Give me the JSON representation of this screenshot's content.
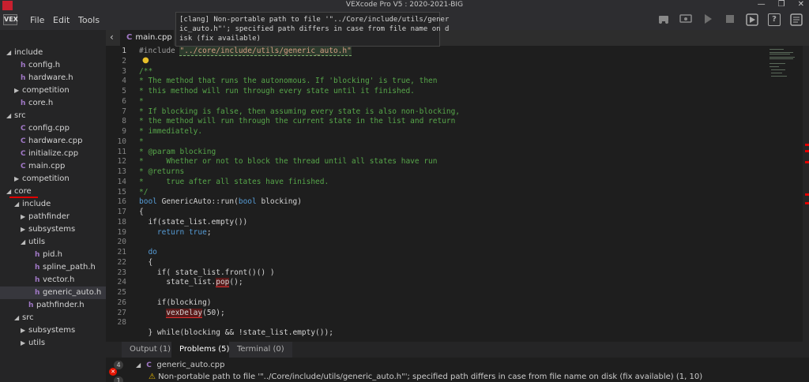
{
  "window": {
    "title": "VEXcode Pro V5 : 2020-2021-BIG",
    "controls": [
      "—",
      "❐",
      "✕"
    ]
  },
  "menu": {
    "logo": "VEX",
    "items": [
      "File",
      "Edit",
      "Tools"
    ]
  },
  "toolbar": {
    "help_label": "?",
    "icons": [
      "robot-icon",
      "devices-icon",
      "play-icon",
      "stop-icon",
      "download-icon",
      "help-icon",
      "user-manual-icon"
    ]
  },
  "explorer": {
    "items": [
      {
        "label": "include",
        "type": "folder",
        "expanded": true
      },
      {
        "label": "config.h",
        "type": "file"
      },
      {
        "label": "hardware.h",
        "type": "file"
      },
      {
        "label": "competition",
        "type": "folder",
        "expanded": false
      },
      {
        "label": "core.h",
        "type": "file"
      },
      {
        "label": "src",
        "type": "folder",
        "expanded": true
      },
      {
        "label": "config.cpp",
        "type": "file"
      },
      {
        "label": "hardware.cpp",
        "type": "file"
      },
      {
        "label": "initialize.cpp",
        "type": "file"
      },
      {
        "label": "main.cpp",
        "type": "file"
      },
      {
        "label": "competition",
        "type": "folder",
        "expanded": false
      },
      {
        "label": "core",
        "type": "folder",
        "expanded": true
      },
      {
        "label": "include",
        "type": "folder",
        "expanded": true
      },
      {
        "label": "pathfinder",
        "type": "folder",
        "expanded": false
      },
      {
        "label": "subsystems",
        "type": "folder",
        "expanded": false
      },
      {
        "label": "utils",
        "type": "folder",
        "expanded": true
      },
      {
        "label": "pid.h",
        "type": "file"
      },
      {
        "label": "spline_path.h",
        "type": "file"
      },
      {
        "label": "vector.h",
        "type": "file"
      },
      {
        "label": "generic_auto.h",
        "type": "file",
        "selected": true
      },
      {
        "label": "pathfinder.h",
        "type": "file"
      },
      {
        "label": "src",
        "type": "folder",
        "expanded": true
      },
      {
        "label": "subsystems",
        "type": "folder",
        "expanded": false
      },
      {
        "label": "utils",
        "type": "folder",
        "expanded": false
      }
    ]
  },
  "editor": {
    "tab_label": "main.cpp",
    "tab_icon": "C",
    "tooltip": "[clang] Non-portable path to file '\"../Core/include/utils/gener\nic_auto.h\"'; specified path differs in case from file name on d\nisk (fix available)",
    "line_numbers": [
      "1",
      "2",
      "3",
      "4",
      "5",
      "6",
      "7",
      "8",
      "9",
      "10",
      "11",
      "12",
      "13",
      "14",
      "15",
      "16",
      "17",
      "18",
      "19",
      "20",
      "21",
      "22",
      "23",
      "24",
      "25",
      "26",
      "27",
      "28"
    ],
    "lines": {
      "l1_directive": "#include ",
      "l1_path": "\"../core/include/utils/generic_auto.h\"",
      "l3": "/**",
      "l4": "* The method that runs the autonomous. If 'blocking' is true, then",
      "l5": "* this method will run through every state until it finished.",
      "l6": "*",
      "l7": "* If blocking is false, then assuming every state is also non-blocking,",
      "l8": "* the method will run through the current state in the list and return",
      "l9": "* immediately.",
      "l10": "*",
      "l11": "* @param blocking",
      "l12": "*     Whether or not to block the thread until all states have run",
      "l13": "* @returns",
      "l14": "*     true after all states have finished.",
      "l15": "*/",
      "l16_kw": "bool",
      "l16_rest": " GenericAuto::run(",
      "l16_kw2": "bool",
      "l16_end": " blocking)",
      "l17": "{",
      "l18": "  if(state_list.empty())",
      "l19_kw": "return",
      "l19_kw2": "true",
      "l19_end": ";",
      "l21": "  do",
      "l22": "  {",
      "l23": "    if( state_list.front()() )",
      "l24_a": "      state_list.",
      "l24_b": "pop",
      "l24_c": "();",
      "l26": "    if(blocking)",
      "l27_a": "      ",
      "l27_b": "vexDelay",
      "l27_c": "(50);",
      "l29": "  } while(blocking && !state_list.empty());"
    }
  },
  "panel": {
    "tabs": [
      "Output (1)",
      "Problems (5)",
      "Terminal (0)"
    ],
    "active_tab": "Problems (5)",
    "badges": [
      "4",
      "1"
    ],
    "file": "generic_auto.cpp",
    "problem": "Non-portable path to file '\"../Core/include/utils/generic_auto.h\"'; specified path differs in case from file name on disk (fix available)",
    "problem_location": "(1, 10)"
  },
  "colors": {
    "error_red": "#e00000",
    "comment_green": "#57a64a",
    "keyword_blue": "#569cd6",
    "file_icon_purple": "#a178c7"
  }
}
